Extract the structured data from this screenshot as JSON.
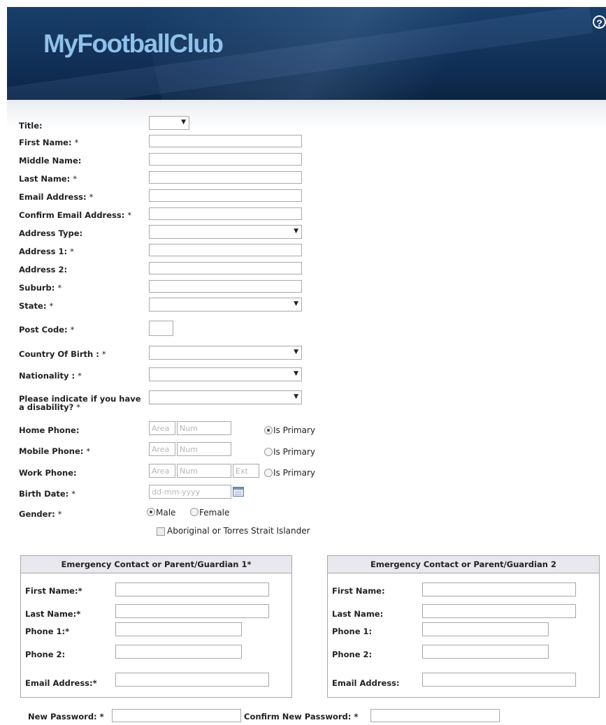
{
  "header": {
    "logo_text": "MyFootballClub",
    "help_glyph": "?"
  },
  "form": {
    "title_label": "Title:",
    "first_name_label": "First Name:",
    "middle_name_label": "Middle Name:",
    "last_name_label": "Last Name:",
    "email_label": "Email Address:",
    "confirm_email_label": "Confirm Email Address:",
    "address_type_label": "Address Type:",
    "address1_label": "Address 1:",
    "address2_label": "Address 2:",
    "suburb_label": "Suburb:",
    "state_label": "State:",
    "postcode_label": "Post Code:",
    "country_label": "Country Of Birth :",
    "nationality_label": "Nationality :",
    "disability_label_1": "Please indicate if you have",
    "disability_label_2": "a disability?",
    "home_phone_label": "Home Phone:",
    "mobile_phone_label": "Mobile Phone:",
    "work_phone_label": "Work Phone:",
    "birth_date_label": "Birth Date:",
    "gender_label": "Gender:",
    "required_mark": "*",
    "area_placeholder": "Area",
    "num_placeholder": "Num",
    "ext_placeholder": "Ext",
    "is_primary": "Is Primary",
    "date_placeholder": "dd-mm-yyyy",
    "male": "Male",
    "female": "Female",
    "aboriginal": "Aboriginal or Torres Strait Islander",
    "home_primary_selected": true,
    "gender_selected": "Male"
  },
  "emergency1": {
    "heading": "Emergency Contact or Parent/Guardian 1*",
    "first_name_label": "First Name:*",
    "last_name_label": "Last Name:*",
    "phone1_label": "Phone 1:*",
    "phone2_label": "Phone 2:",
    "email_label": "Email Address:*"
  },
  "emergency2": {
    "heading": "Emergency Contact or Parent/Guardian 2",
    "first_name_label": "First Name:",
    "last_name_label": "Last Name:",
    "phone1_label": "Phone 1:",
    "phone2_label": "Phone 2:",
    "email_label": "Email Address:"
  },
  "password": {
    "new_label": "New Password: *",
    "confirm_label": "Confirm New Password: *"
  },
  "icons": {
    "help": "help-icon",
    "calendar": "calendar-icon",
    "dropdown": "chevron-down-icon"
  }
}
